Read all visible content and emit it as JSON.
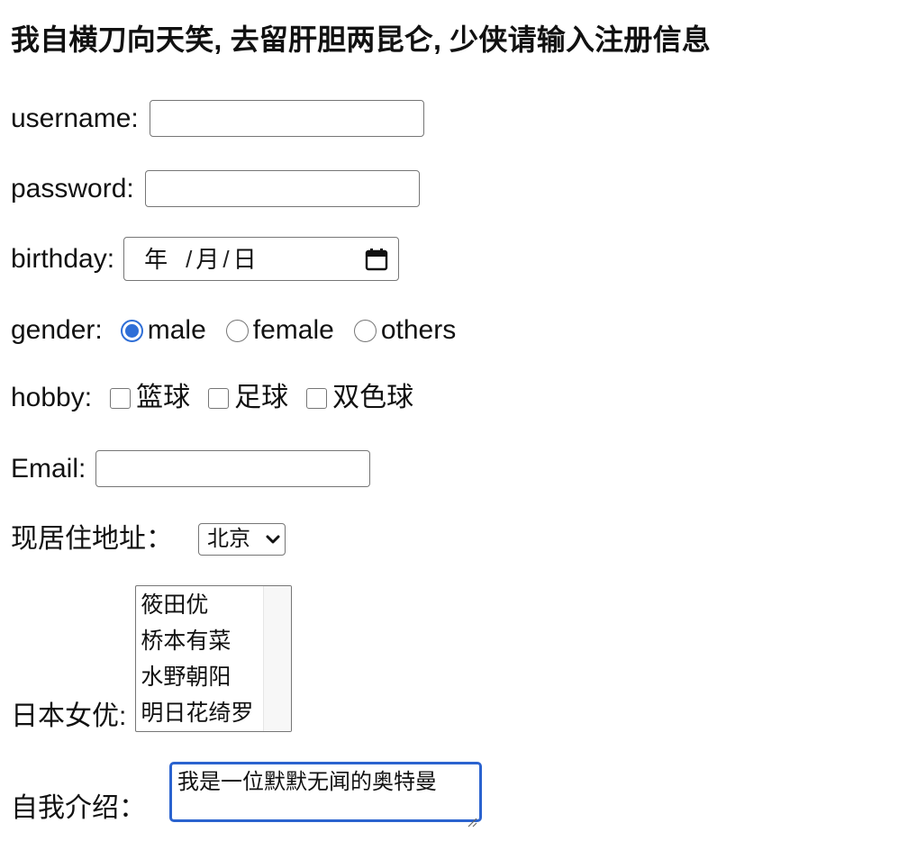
{
  "heading": "我自横刀向天笑, 去留肝胆两昆仑, 少侠请输入注册信息",
  "username": {
    "label": "username:",
    "value": ""
  },
  "password": {
    "label": "password:",
    "value": ""
  },
  "birthday": {
    "label": "birthday:",
    "year": "年",
    "month": "月",
    "day": "日",
    "separator": "/",
    "icon": "calendar-icon"
  },
  "gender": {
    "label": "gender:",
    "options": [
      {
        "label": "male",
        "checked": true
      },
      {
        "label": "female",
        "checked": false
      },
      {
        "label": "others",
        "checked": false
      }
    ]
  },
  "hobby": {
    "label": "hobby:",
    "options": [
      {
        "label": "篮球",
        "checked": false
      },
      {
        "label": "足球",
        "checked": false
      },
      {
        "label": "双色球",
        "checked": false
      }
    ]
  },
  "email": {
    "label": "Email:",
    "value": ""
  },
  "address": {
    "label": "现居住地址：",
    "selected": "北京",
    "icon": "chevron-down-icon"
  },
  "actress": {
    "label": "日本女优:",
    "options": [
      "筱田优",
      "桥本有菜",
      "水野朝阳",
      "明日花绮罗"
    ]
  },
  "intro": {
    "label": "自我介绍：",
    "value": "我是一位默默无闻的奥特曼"
  },
  "colors": {
    "accent": "#2f6fd7",
    "focus_border": "#2b63cf",
    "border": "#767676"
  }
}
